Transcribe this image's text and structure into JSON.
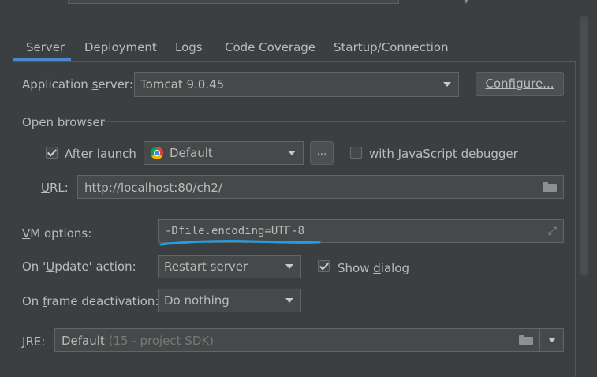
{
  "tabs": [
    {
      "label": "Server"
    },
    {
      "label": "Deployment"
    },
    {
      "label": "Logs"
    },
    {
      "label": "Code Coverage"
    },
    {
      "label": "Startup/Connection"
    }
  ],
  "app_server": {
    "label_pre": "Application ",
    "label_u": "s",
    "label_post": "erver:",
    "value": "Tomcat 9.0.45",
    "configure_label": "Configure..."
  },
  "open_browser": {
    "title": "Open browser",
    "after_launch_label": "After launch",
    "browser_value": "Default",
    "more_label": "...",
    "js_debugger_pre": "with ",
    "js_debugger_u": "J",
    "js_debugger_post": "avaScript debugger",
    "url_label_u": "U",
    "url_label_post": "RL:",
    "url_value": "http://localhost:80/ch2/"
  },
  "vm_options": {
    "label_u": "V",
    "label_post": "M options:",
    "value": "-Dfile.encoding=UTF-8"
  },
  "update_action": {
    "label_pre": "On '",
    "label_u": "U",
    "label_post": "pdate' action:",
    "value": "Restart server",
    "show_dialog_pre": "Show ",
    "show_dialog_u": "d",
    "show_dialog_post": "ialog"
  },
  "frame_deactivation": {
    "label_pre": "On ",
    "label_u": "f",
    "label_post": "rame deactivation:",
    "value": "Do nothing"
  },
  "jre": {
    "label_u": "J",
    "label_post": "RE:",
    "value": "Default",
    "hint": "(15 - project SDK)"
  },
  "colors": {
    "accent": "#4a88c7",
    "annotation": "#1e9ee8"
  }
}
